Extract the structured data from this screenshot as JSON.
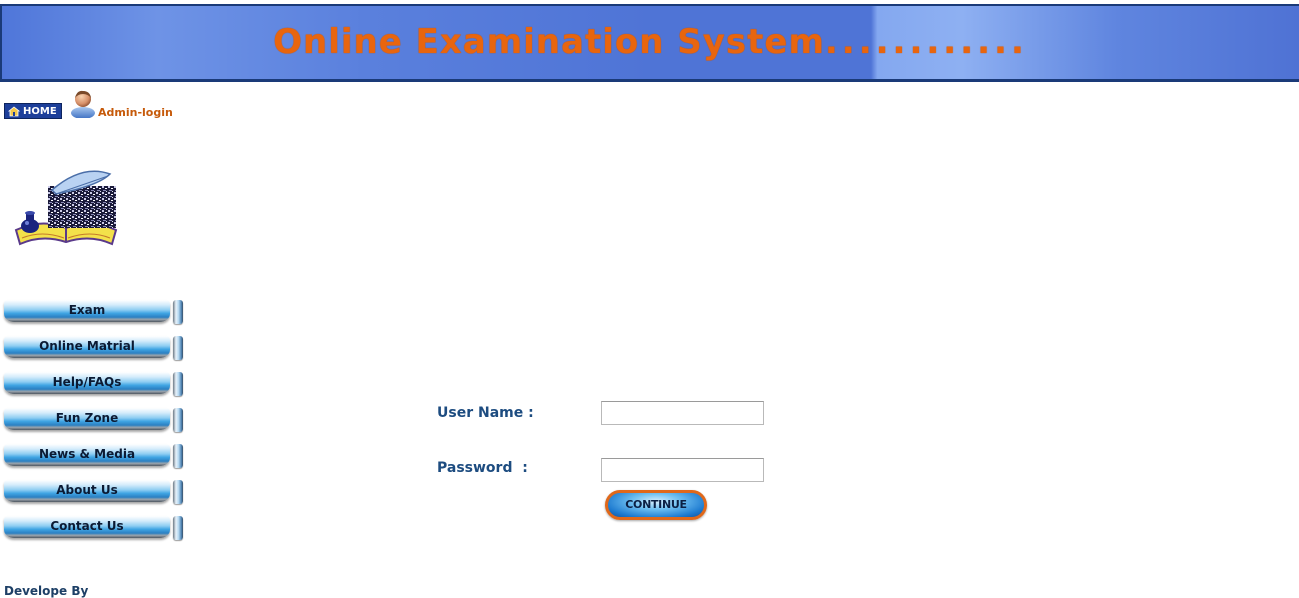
{
  "header": {
    "title": "Online Examination System",
    "title_dots": "............",
    "title_color": "#e8650e",
    "banner_color": "#4f74d6"
  },
  "topnav": {
    "home_label": "HOME",
    "admin_label": "Admin-login"
  },
  "logo": {
    "icon": "book-and-quill-icon"
  },
  "menu": {
    "items": [
      {
        "label": "Exam"
      },
      {
        "label": "Online Matrial"
      },
      {
        "label": "Help/FAQs"
      },
      {
        "label": "Fun Zone"
      },
      {
        "label": "News & Media"
      },
      {
        "label": "About Us"
      },
      {
        "label": "Contact Us"
      }
    ]
  },
  "login_form": {
    "username_label": "User Name :",
    "username_value": "",
    "password_label": "Password  :",
    "password_value": "",
    "continue_label": "CONTINUE",
    "label_color": "#1d4c80",
    "button_border_color": "#e0681a"
  },
  "footer": {
    "text": "Develope By"
  }
}
